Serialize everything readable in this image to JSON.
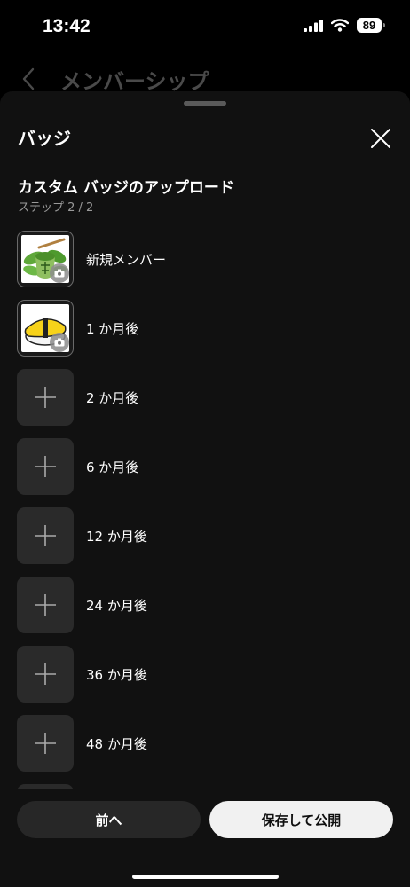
{
  "status_bar": {
    "time": "13:42",
    "battery": "89",
    "icons": [
      "signal-icon",
      "wifi-icon",
      "battery-icon"
    ]
  },
  "background_page": {
    "title": "メンバーシップ",
    "back_icon": "chevron-left-icon"
  },
  "sheet": {
    "title": "バッジ",
    "close_icon": "close-icon",
    "section_title": "カスタム バッジのアップロード",
    "step": "ステップ 2 / 2",
    "badges": [
      {
        "label": "新規メンバー",
        "state": "uploaded",
        "image": "matcha-tea-badge"
      },
      {
        "label": "1 か月後",
        "state": "uploaded",
        "image": "tamago-sushi-badge"
      },
      {
        "label": "2 か月後",
        "state": "empty"
      },
      {
        "label": "6 か月後",
        "state": "empty"
      },
      {
        "label": "12 か月後",
        "state": "empty"
      },
      {
        "label": "24 か月後",
        "state": "empty"
      },
      {
        "label": "36 か月後",
        "state": "empty"
      },
      {
        "label": "48 か月後",
        "state": "empty"
      }
    ],
    "buttons": {
      "prev": "前へ",
      "save": "保存して公開"
    }
  },
  "colors": {
    "background": "#000000",
    "sheet": "#111111",
    "tile": "#2a2a2a",
    "primary_button": "#f1f1f1",
    "secondary_button": "#272727"
  }
}
